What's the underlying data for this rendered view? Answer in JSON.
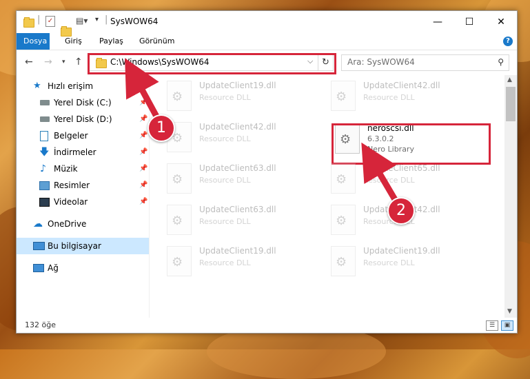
{
  "window": {
    "title": "SysWOW64",
    "controls": {
      "minimize": "—",
      "maximize": "☐",
      "close": "✕"
    }
  },
  "ribbon": {
    "tabs": [
      "Dosya",
      "Giriş",
      "Paylaş",
      "Görünüm"
    ],
    "help": "?"
  },
  "navigation": {
    "address": "C:\\Windows\\SysWOW64",
    "search_placeholder": "Ara: SysWOW64"
  },
  "sidebar": {
    "quick_access": "Hızlı erişim",
    "pinned": [
      {
        "label": "Yerel Disk (C:)",
        "icon": "drive-icon"
      },
      {
        "label": "Yerel Disk (D:)",
        "icon": "drive-icon"
      },
      {
        "label": "Belgeler",
        "icon": "documents-icon"
      },
      {
        "label": "İndirmeler",
        "icon": "downloads-icon"
      },
      {
        "label": "Müzik",
        "icon": "music-icon"
      },
      {
        "label": "Resimler",
        "icon": "pictures-icon"
      },
      {
        "label": "Videolar",
        "icon": "videos-icon"
      }
    ],
    "onedrive": "OneDrive",
    "this_pc": "Bu bilgisayar",
    "network": "Ağ"
  },
  "files": [
    {
      "name": "UpdateClient19.dll",
      "type": "Resource DLL"
    },
    {
      "name": "UpdateClient42.dll",
      "type": "Resource DLL"
    },
    {
      "name": "UpdateClient42.dll",
      "type": "Resource DLL"
    },
    {
      "name": "neroscsi.dll",
      "version": "6.3.0.2",
      "type": "Nero Library",
      "highlighted": true
    },
    {
      "name": "UpdateClient63.dll",
      "type": "Resource DLL"
    },
    {
      "name": "UpdateClient65.dll",
      "type": "Resource DLL"
    },
    {
      "name": "UpdateClient63.dll",
      "type": "Resource DLL"
    },
    {
      "name": "UpdateClient42.dll",
      "type": "Resource DLL"
    },
    {
      "name": "UpdateClient19.dll",
      "type": "Resource DLL"
    },
    {
      "name": "UpdateClient19.dll",
      "type": "Resource DLL"
    }
  ],
  "status": {
    "item_count": "132 öğe"
  },
  "annotations": {
    "step1": "1",
    "step2": "2",
    "color": "#d6253a"
  }
}
